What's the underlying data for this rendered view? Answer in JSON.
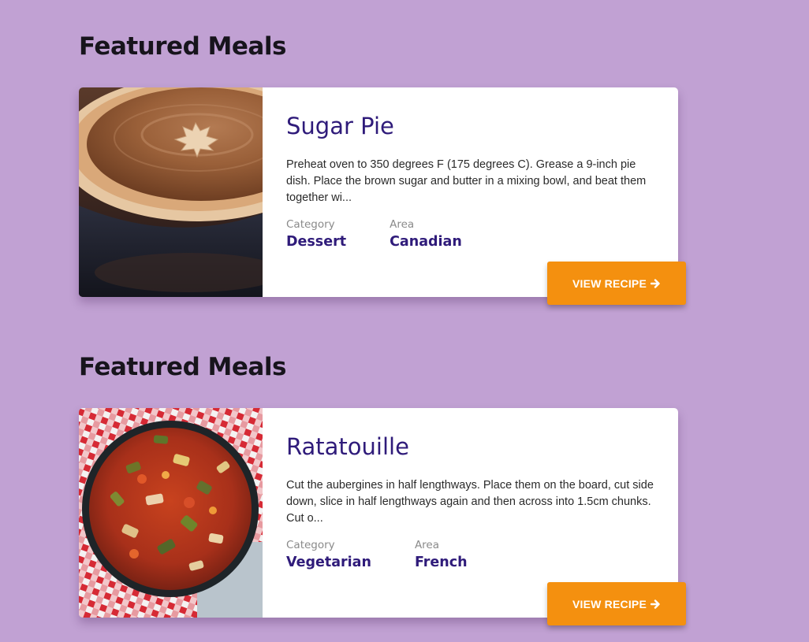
{
  "sections": [
    {
      "title": "Featured Meals",
      "meal": {
        "name": "Sugar Pie",
        "description": "Preheat oven to 350 degrees F (175 degrees C). Grease a 9-inch pie dish. Place the brown sugar and butter in a mixing bowl, and beat them together wi...",
        "category_label": "Category",
        "category": "Dessert",
        "area_label": "Area",
        "area": "Canadian",
        "button_label": "VIEW RECIPE",
        "button_icon": "arrow-right-icon",
        "image": "sugar-pie-photo"
      }
    },
    {
      "title": "Featured Meals",
      "meal": {
        "name": "Ratatouille",
        "description": "Cut the aubergines in half lengthways. Place them on the board, cut side down, slice in half lengthways again and then across into 1.5cm chunks. Cut o...",
        "category_label": "Category",
        "category": "Vegetarian",
        "area_label": "Area",
        "area": "French",
        "button_label": "VIEW RECIPE",
        "button_icon": "arrow-right-icon",
        "image": "ratatouille-photo"
      }
    }
  ],
  "colors": {
    "background": "#c1a1d3",
    "accent": "#f4900f",
    "heading": "#2f1b7a"
  }
}
